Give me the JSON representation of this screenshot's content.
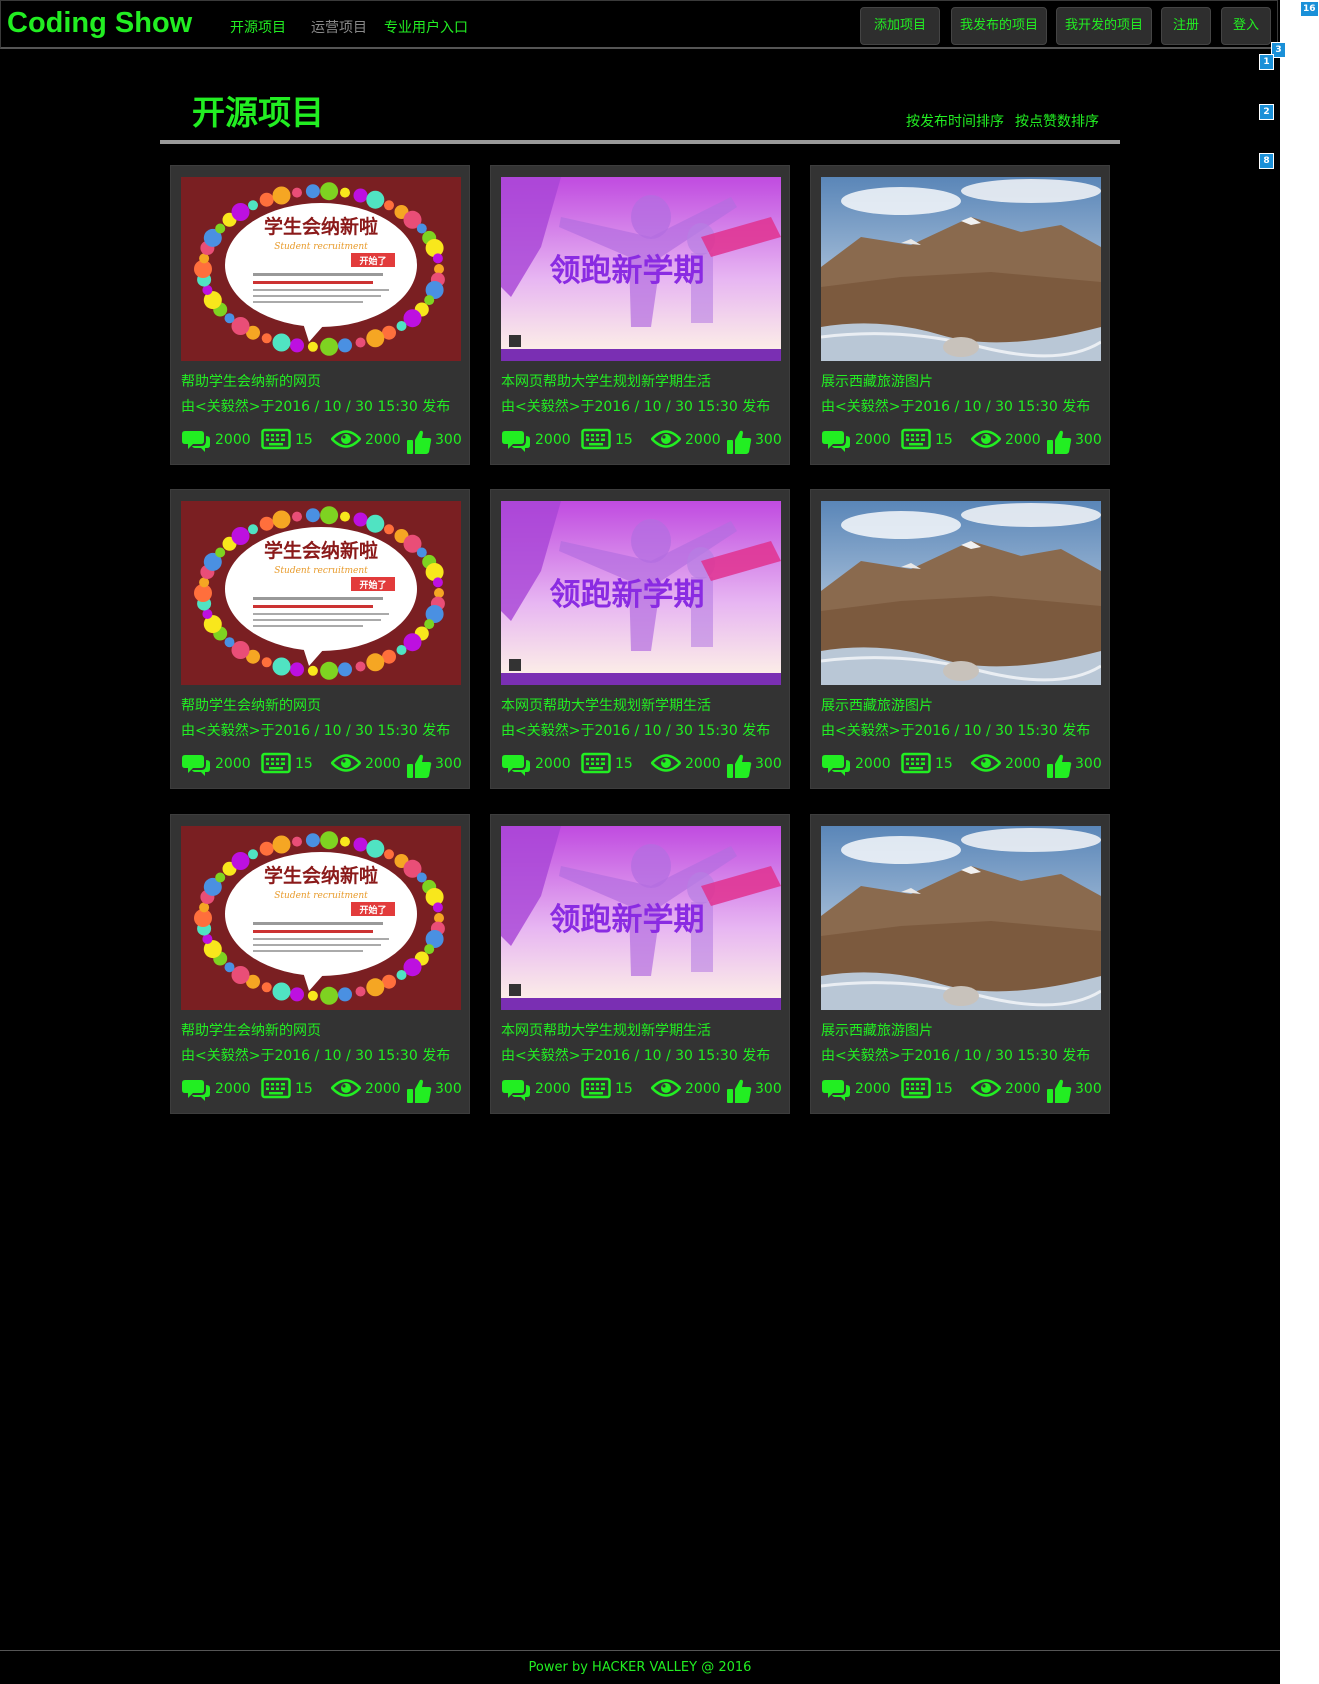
{
  "brand": "Coding Show",
  "nav_links": [
    {
      "label": "开源项目",
      "color": "#22ee22"
    },
    {
      "label": "运营项目",
      "color": "#8a8a8a"
    },
    {
      "label": "专业用户入口",
      "color": "#22ee22"
    }
  ],
  "nav_buttons": [
    "添加项目",
    "我发布的项目",
    "我开发的项目",
    "注册",
    "登入"
  ],
  "page_title": "开源项目",
  "sort_links": [
    "按发布时间排序",
    "按点赞数排序"
  ],
  "cards": [
    {
      "image": "recruitment-poster",
      "title": "帮助学生会纳新的网页",
      "meta": "由<关毅然>于2016 / 10 / 30 15:30  发布",
      "stats": {
        "comments": "2000",
        "code": "15",
        "views": "2000",
        "likes": "300"
      }
    },
    {
      "image": "new-semester-poster",
      "title": "本网页帮助大学生规划新学期生活",
      "meta": "由<关毅然>于2016 / 10 / 30 15:30  发布",
      "stats": {
        "comments": "2000",
        "code": "15",
        "views": "2000",
        "likes": "300"
      }
    },
    {
      "image": "tibet-landscape",
      "title": "展示西藏旅游图片",
      "meta": "由<关毅然>于2016 / 10 / 30 15:30  发布",
      "stats": {
        "comments": "2000",
        "code": "15",
        "views": "2000",
        "likes": "300"
      }
    },
    {
      "image": "recruitment-poster",
      "title": "帮助学生会纳新的网页",
      "meta": "由<关毅然>于2016 / 10 / 30 15:30  发布",
      "stats": {
        "comments": "2000",
        "code": "15",
        "views": "2000",
        "likes": "300"
      }
    },
    {
      "image": "new-semester-poster",
      "title": "本网页帮助大学生规划新学期生活",
      "meta": "由<关毅然>于2016 / 10 / 30 15:30  发布",
      "stats": {
        "comments": "2000",
        "code": "15",
        "views": "2000",
        "likes": "300"
      }
    },
    {
      "image": "tibet-landscape",
      "title": "展示西藏旅游图片",
      "meta": "由<关毅然>于2016 / 10 / 30 15:30  发布",
      "stats": {
        "comments": "2000",
        "code": "15",
        "views": "2000",
        "likes": "300"
      }
    },
    {
      "image": "recruitment-poster",
      "title": "帮助学生会纳新的网页",
      "meta": "由<关毅然>于2016 / 10 / 30 15:30  发布",
      "stats": {
        "comments": "2000",
        "code": "15",
        "views": "2000",
        "likes": "300"
      }
    },
    {
      "image": "new-semester-poster",
      "title": "本网页帮助大学生规划新学期生活",
      "meta": "由<关毅然>于2016 / 10 / 30 15:30  发布",
      "stats": {
        "comments": "2000",
        "code": "15",
        "views": "2000",
        "likes": "300"
      }
    },
    {
      "image": "tibet-landscape",
      "title": "展示西藏旅游图片",
      "meta": "由<关毅然>于2016 / 10 / 30 15:30  发布",
      "stats": {
        "comments": "2000",
        "code": "15",
        "views": "2000",
        "likes": "300"
      }
    }
  ],
  "poster_text": {
    "recruitment_headline": "学生会纳新啦",
    "recruitment_sub": "Student recruitment",
    "recruitment_badge": "开始了",
    "semester_headline": "领跑新学期"
  },
  "footer": "Power by HACKER VALLEY @ 2016",
  "markers": [
    "16",
    "3",
    "1",
    "2",
    "8"
  ],
  "colors": {
    "accent": "#22ee22",
    "background": "#000000",
    "card": "#333333",
    "button": "#2e2e2e",
    "marker": "#1a90d8",
    "muted_nav": "#8a8a8a"
  }
}
